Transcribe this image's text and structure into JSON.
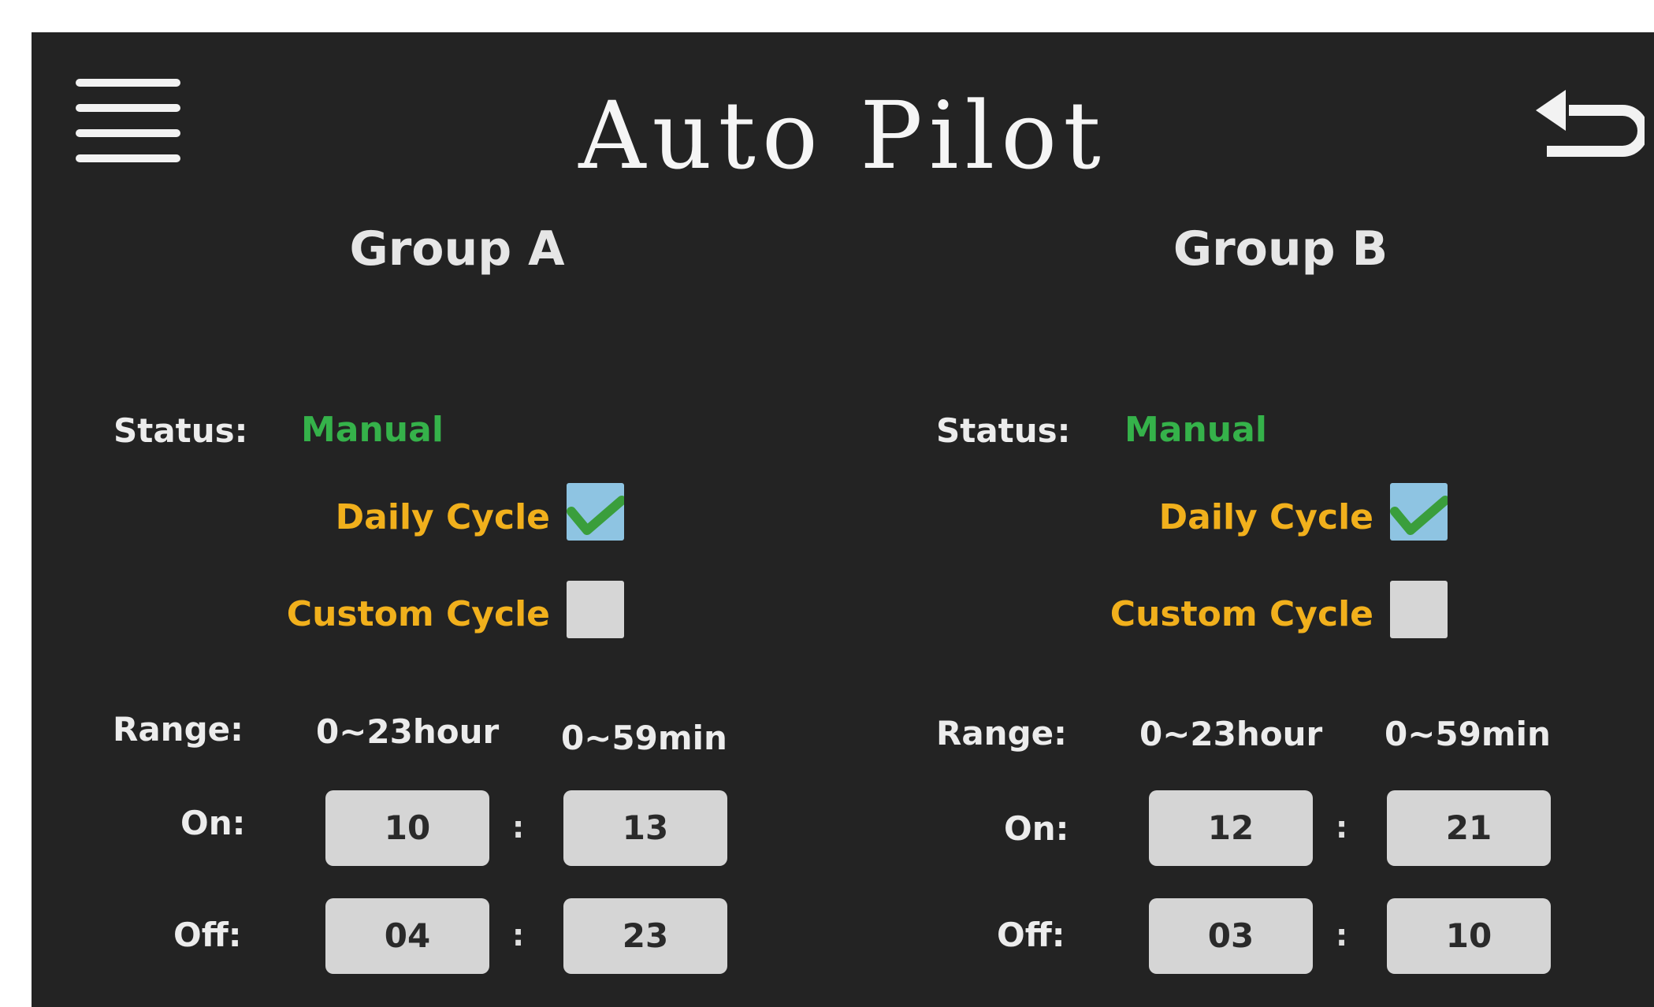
{
  "header": {
    "title": "Auto Pilot",
    "menu_icon": "hamburger-menu-icon",
    "back_icon": "return-arrow-icon"
  },
  "labels": {
    "status": "Status:",
    "range": "Range:",
    "on": "On:",
    "off": "Off:",
    "colon": ":"
  },
  "groups": [
    {
      "title": "Group A",
      "status": "Manual",
      "daily_cycle_label": "Daily Cycle",
      "daily_cycle_checked": true,
      "custom_cycle_label": "Custom Cycle",
      "custom_cycle_checked": false,
      "range_hour": "0~23hour",
      "range_min": "0~59min",
      "on_hour": "10",
      "on_min": "13",
      "off_hour": "04",
      "off_min": "23"
    },
    {
      "title": "Group B",
      "status": "Manual",
      "daily_cycle_label": "Daily Cycle",
      "daily_cycle_checked": true,
      "custom_cycle_label": "Custom Cycle",
      "custom_cycle_checked": false,
      "range_hour": "0~23hour",
      "range_min": "0~59min",
      "on_hour": "12",
      "on_min": "21",
      "off_hour": "03",
      "off_min": "10"
    }
  ],
  "colors": {
    "background": "#232323",
    "status_green": "#35b24a",
    "cycle_label_orange": "#f1b01c",
    "checkbox_checked": "#8ec4e2",
    "checkmark": "#3a9e3c",
    "time_box": "#d5d5d5"
  }
}
